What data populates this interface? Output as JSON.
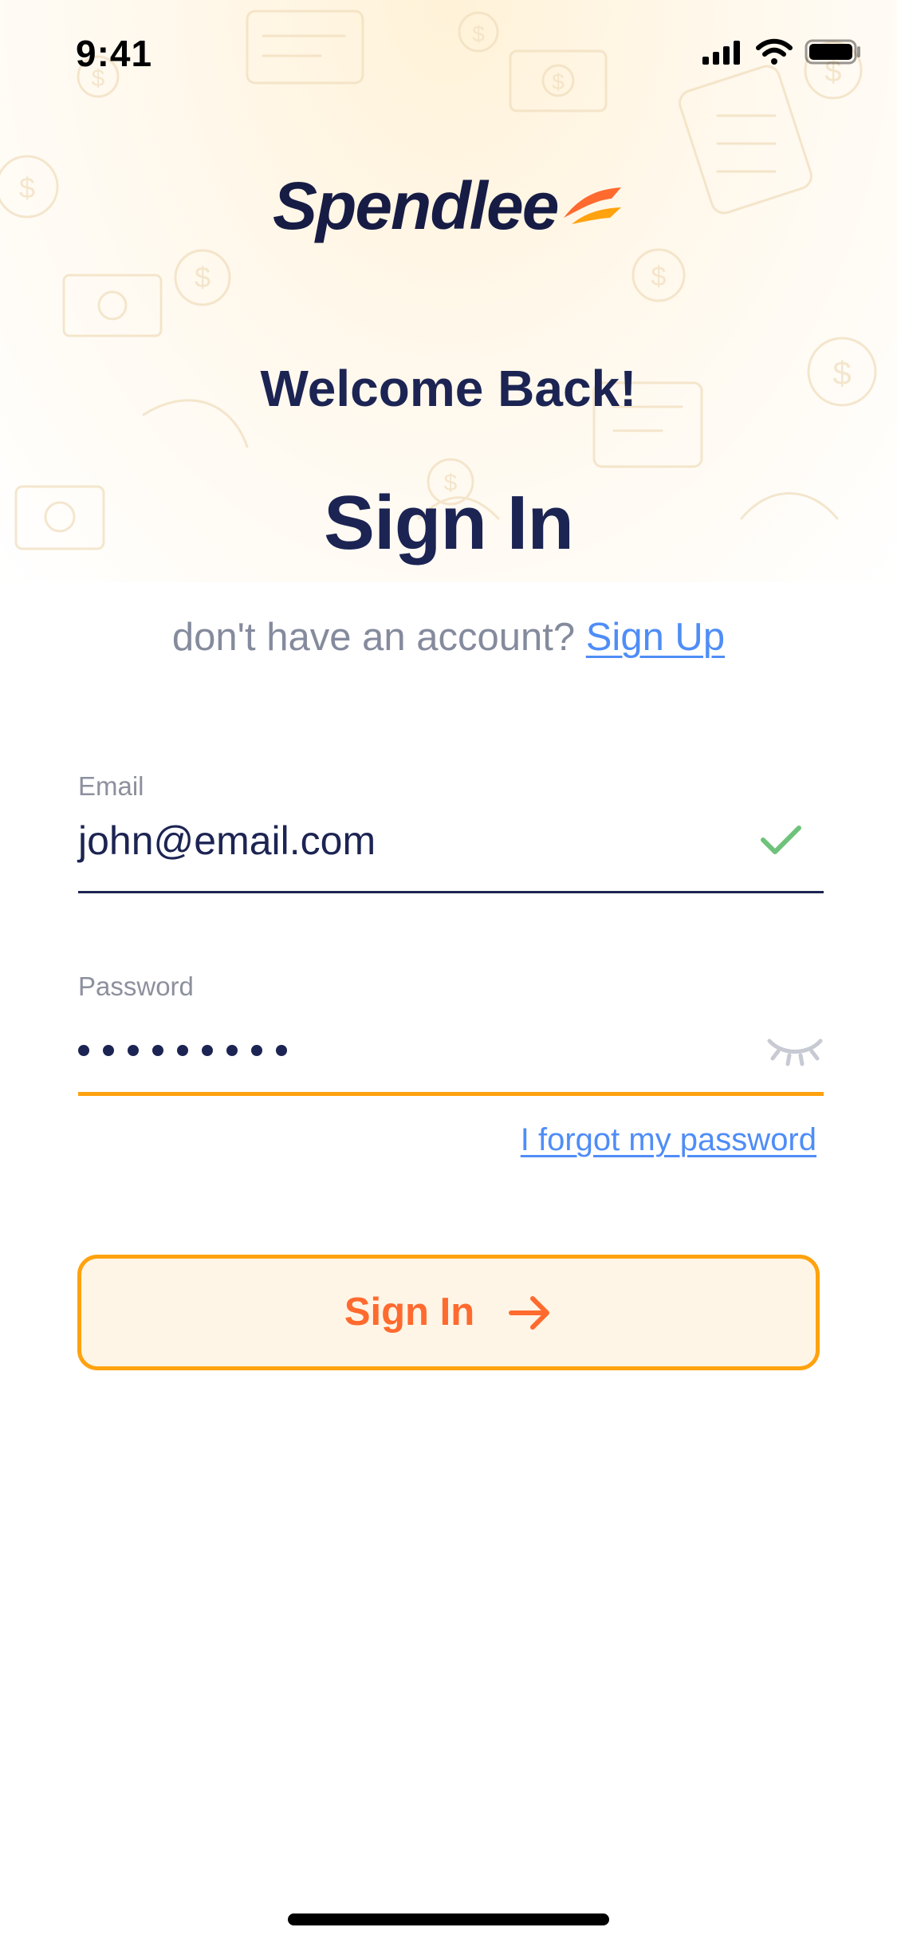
{
  "status_bar": {
    "time": "9:41",
    "icons": [
      "signal-icon",
      "wifi-icon",
      "battery-icon"
    ]
  },
  "brand": {
    "name": "Spendlee",
    "accent": "#ff6a2e",
    "primary": "#1c2453"
  },
  "header": {
    "welcome": "Welcome Back!",
    "title": "Sign In"
  },
  "signup": {
    "prompt": "don't have an account?",
    "link": "Sign Up"
  },
  "form": {
    "email": {
      "label": "Email",
      "value": "john@email.com",
      "status_icon": "check-icon"
    },
    "password": {
      "label": "Password",
      "masked_length": 9,
      "toggle_icon": "eye-closed-icon"
    },
    "forgot": "I forgot my password"
  },
  "actions": {
    "submit": "Sign In",
    "submit_icon": "arrow-right-icon"
  },
  "colors": {
    "link": "#4f8df7",
    "focus": "#ffa20f",
    "muted": "#858b9d",
    "success": "#6fc27b",
    "button_bg": "#fff5e6"
  }
}
